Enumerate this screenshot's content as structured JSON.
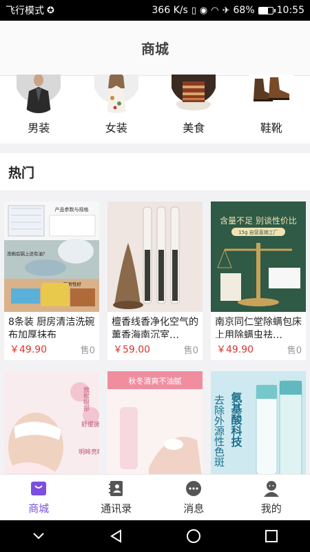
{
  "status_bar": {
    "airplane_mode": "飞行模式",
    "speed": "366 K/s",
    "battery": "68%",
    "battery_level": 0.68,
    "time": "10:55"
  },
  "header": {
    "title": "商城"
  },
  "categories": [
    {
      "label": "男装",
      "icon": "men-clothing-image"
    },
    {
      "label": "女装",
      "icon": "women-clothing-image"
    },
    {
      "label": "美食",
      "icon": "food-image"
    },
    {
      "label": "鞋靴",
      "icon": "shoes-image"
    }
  ],
  "hot": {
    "title": "热门"
  },
  "products": [
    {
      "title": "8条装 厨房清洁洗碗布加厚抹布",
      "price": "￥49.90",
      "sold": "售0",
      "img_text_1": "产品参数与规格",
      "img_text_2": "洗碗后锅上还有油？",
      "img_text_3": "吸附性好"
    },
    {
      "title": "檀香线香净化空气的薰香海南沉室…",
      "price": "￥59.00",
      "sold": "售0"
    },
    {
      "title": "南京同仁堂除螨包床上用除螨虫祛…",
      "price": "￥49.90",
      "sold": "售0",
      "img_text_1": "含量不足 别谈性价比",
      "img_text_2": "15g 自营直销工厂"
    },
    {
      "title": "",
      "price": "",
      "sold": "",
      "img_text_1": "放松眼部",
      "img_text_2": "舒缓疲劳",
      "img_text_3": "明眸亮眼"
    },
    {
      "title": "",
      "price": "",
      "sold": "",
      "img_text_1": "秋冬清爽不油腻"
    },
    {
      "title": "",
      "price": "",
      "sold": "",
      "img_text_1": "氨基酸科技",
      "img_text_2": "去除外源性色斑"
    }
  ],
  "tabs": [
    {
      "label": "商城",
      "icon": "shop-bag-icon",
      "active": true
    },
    {
      "label": "通讯录",
      "icon": "contacts-icon",
      "active": false
    },
    {
      "label": "消息",
      "icon": "message-icon",
      "active": false
    },
    {
      "label": "我的",
      "icon": "profile-icon",
      "active": false
    }
  ],
  "colors": {
    "accent": "#7b4fe0",
    "price": "#e0322a"
  }
}
